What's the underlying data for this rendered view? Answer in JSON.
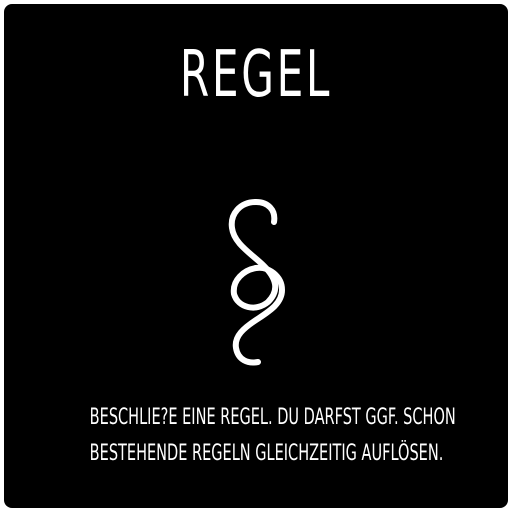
{
  "card": {
    "title": "REGEL",
    "icon": "section-sign-icon",
    "text_lines": [
      "BESCHLIE?E EINE REGEL. DU DARFST GGF. SCHON",
      "BESTEHENDE REGELN GLEICHZEITIG AUFLÖSEN."
    ]
  },
  "colors": {
    "background": "#000000",
    "foreground": "#ffffff"
  }
}
